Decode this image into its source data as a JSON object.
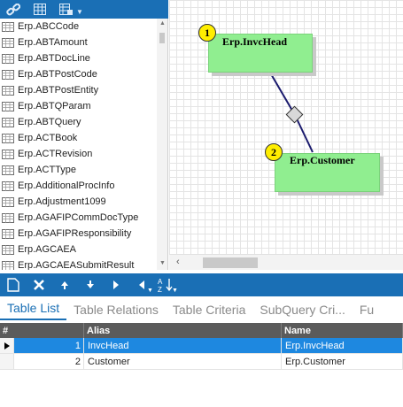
{
  "toolbar_top": {
    "icons": [
      "link-icon",
      "grid-icon",
      "table-options-icon"
    ]
  },
  "table_list": {
    "items": [
      "Erp.ABCCode",
      "Erp.ABTAmount",
      "Erp.ABTDocLine",
      "Erp.ABTPostCode",
      "Erp.ABTPostEntity",
      "Erp.ABTQParam",
      "Erp.ABTQuery",
      "Erp.ACTBook",
      "Erp.ACTRevision",
      "Erp.ACTType",
      "Erp.AdditionalProcInfo",
      "Erp.Adjustment1099",
      "Erp.AGAFIPCommDocType",
      "Erp.AGAFIPResponsibility",
      "Erp.AGCAEA",
      "Erp.AGCAEASubmitResult"
    ]
  },
  "diagram": {
    "nodes": [
      {
        "badge": "1",
        "title": "Erp.InvcHead"
      },
      {
        "badge": "2",
        "title": "Erp.Customer"
      }
    ],
    "colors": {
      "node_fill": "#90ee90",
      "badge_fill": "#ffee00",
      "link": "#1b1b6e"
    }
  },
  "toolbar_bottom": {
    "icons": [
      "new-icon",
      "delete-icon",
      "move-up-icon",
      "move-down-icon",
      "move-right-icon",
      "move-left-icon",
      "sort-icon"
    ]
  },
  "tabs": [
    {
      "label": "Table List",
      "active": true
    },
    {
      "label": "Table Relations",
      "active": false
    },
    {
      "label": "Table Criteria",
      "active": false
    },
    {
      "label": "SubQuery Cri...",
      "active": false
    },
    {
      "label": "Fu",
      "active": false
    }
  ],
  "grid": {
    "headers": [
      "#",
      "Alias",
      "Name"
    ],
    "rows": [
      {
        "num": "1",
        "alias": "InvcHead",
        "name": "Erp.InvcHead",
        "selected": true
      },
      {
        "num": "2",
        "alias": "Customer",
        "name": "Erp.Customer",
        "selected": false
      }
    ]
  },
  "colors": {
    "accent": "#1a6fb5",
    "selection": "#1e88e0",
    "grid_header": "#5b5b5b"
  }
}
